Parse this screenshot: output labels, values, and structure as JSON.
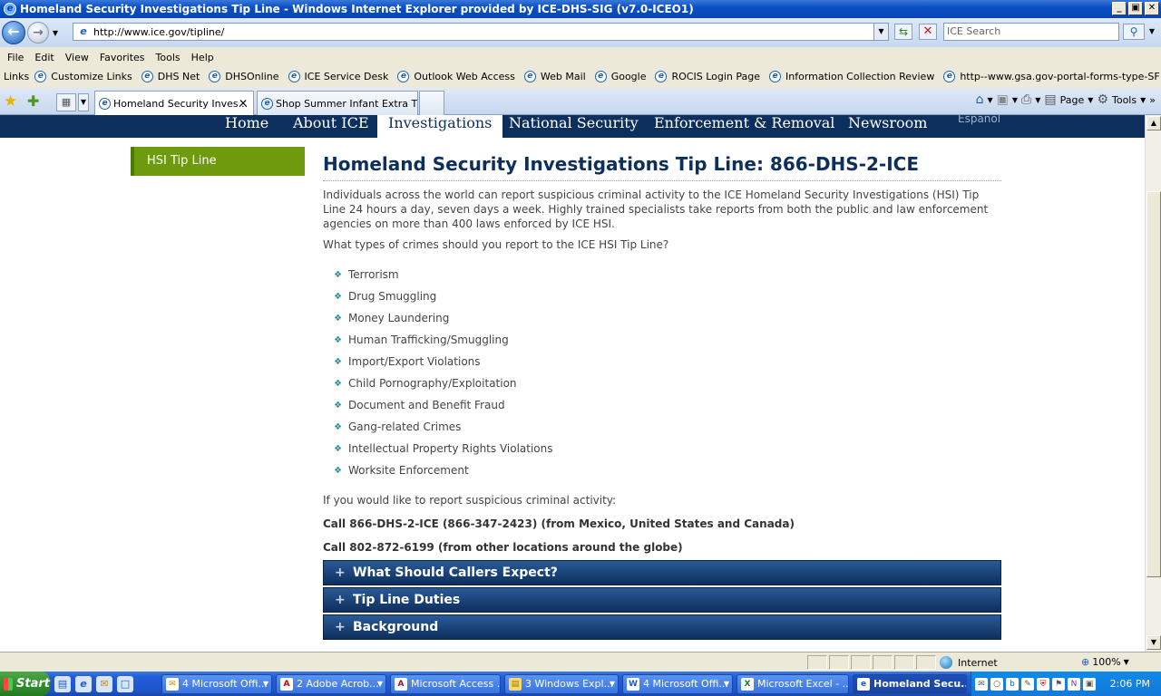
{
  "window": {
    "title": "Homeland Security Investigations Tip Line - Windows Internet Explorer provided by ICE-DHS-SIG (v7.0-ICEO1)",
    "minimize": "_",
    "maximize": "▣",
    "close": "✕"
  },
  "address": {
    "url": "http://www.ice.gov/tipline/",
    "search_placeholder": "ICE Search"
  },
  "menu": [
    "File",
    "Edit",
    "View",
    "Favorites",
    "Tools",
    "Help"
  ],
  "links": {
    "label": "Links",
    "items": [
      "Customize Links",
      "DHS Net",
      "DHSOnline",
      "ICE Service Desk",
      "Outlook Web Access",
      "Web Mail",
      "Google",
      "ROCIS Login Page",
      "Information Collection Review",
      "http--www.gsa.gov-portal-forms-type-SF"
    ]
  },
  "tabs": [
    {
      "label": "Homeland Security Inves...",
      "active": true
    },
    {
      "label": "Shop Summer Infant Extra T...",
      "active": false
    }
  ],
  "commands": {
    "page": "Page",
    "tools": "Tools"
  },
  "site_nav": {
    "items": [
      "Home",
      "About ICE",
      "Investigations",
      "National Security",
      "Enforcement & Removal",
      "Newsroom"
    ],
    "active": "Investigations",
    "language": "Español"
  },
  "sidebar": {
    "item": "HSI Tip Line"
  },
  "content": {
    "title": "Homeland Security Investigations Tip Line: 866-DHS-2-ICE",
    "intro": "Individuals across the world can report suspicious criminal activity to the ICE Homeland Security Investigations (HSI) Tip Line 24 hours a day, seven days a week. Highly trained specialists take reports from both the public and law enforcement agencies on more than 400 laws enforced by ICE HSI.",
    "question": "What types of crimes should you report to the ICE HSI Tip Line?",
    "crimes": [
      "Terrorism",
      "Drug Smuggling",
      "Money Laundering",
      "Human Trafficking/Smuggling",
      "Import/Export Violations",
      "Child Pornography/Exploitation",
      "Document and Benefit Fraud",
      "Gang-related Crimes",
      "Intellectual Property Rights Violations",
      "Worksite Enforcement"
    ],
    "report_text": "If you would like to report suspicious criminal activity:",
    "call1": "Call 866-DHS-2-ICE (866-347-2423) (from Mexico, United States and Canada)",
    "call2": "Call 802-872-6199 (from other locations around the globe)",
    "accordions": [
      "What Should Callers Expect?",
      "Tip Line Duties",
      "Background"
    ]
  },
  "status": {
    "zone": "Internet",
    "zoom": "100%"
  },
  "taskbar": {
    "start": "Start",
    "tasks": [
      {
        "label": "4 Microsoft Offi...",
        "active": false
      },
      {
        "label": "2 Adobe Acrob...",
        "active": false
      },
      {
        "label": "Microsoft Access ...",
        "active": false
      },
      {
        "label": "3 Windows Expl...",
        "active": false
      },
      {
        "label": "4 Microsoft Offi...",
        "active": false
      },
      {
        "label": "Microsoft Excel - ...",
        "active": false
      },
      {
        "label": "Homeland Secu...",
        "active": true
      }
    ],
    "clock": "2:06 PM"
  },
  "colors": {
    "nav_blue": "#0d2f5e",
    "sidebar_green": "#6d9b0d",
    "bullet": "#2a8a9a"
  }
}
